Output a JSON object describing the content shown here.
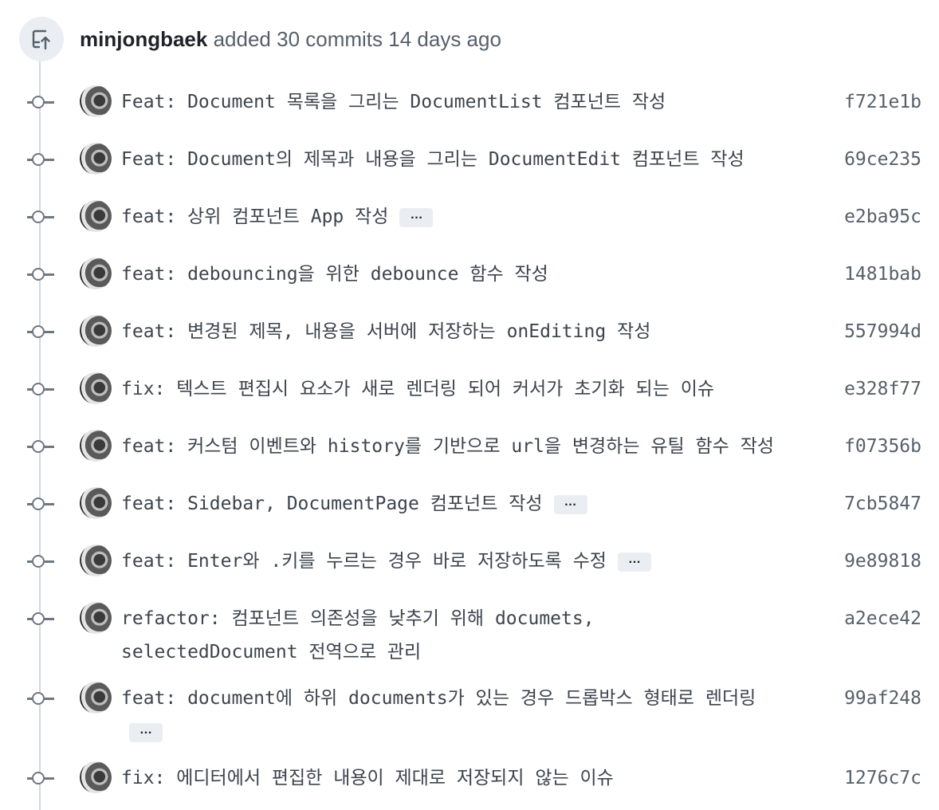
{
  "header": {
    "author": "minjongbaek",
    "action": " added 30 commits 14 days ago"
  },
  "commits": [
    {
      "message": "Feat: Document 목록을 그리는 DocumentList 컴포넌트 작성",
      "sha": "f721e1b"
    },
    {
      "message": "Feat: Document의 제목과 내용을 그리는 DocumentEdit 컴포넌트 작성",
      "sha": "69ce235"
    },
    {
      "message": "feat: 상위 컴포넌트 App 작성",
      "sha": "e2ba95c",
      "expander": "…"
    },
    {
      "message": "feat: debouncing을 위한 debounce 함수 작성",
      "sha": "1481bab"
    },
    {
      "message": "feat: 변경된 제목, 내용을 서버에 저장하는 onEditing 작성",
      "sha": "557994d"
    },
    {
      "message": "fix: 텍스트 편집시 요소가 새로 렌더링 되어 커서가 초기화 되는 이슈",
      "sha": "e328f77"
    },
    {
      "message": "feat: 커스텀 이벤트와 history를 기반으로 url을 변경하는 유틸 함수 작성",
      "sha": "f07356b"
    },
    {
      "message": "feat: Sidebar, DocumentPage 컴포넌트 작성",
      "sha": "7cb5847",
      "expander": "…"
    },
    {
      "message": "feat: Enter와 .키를 누르는 경우 바로 저장하도록 수정",
      "sha": "9e89818",
      "expander": "…"
    },
    {
      "message": "refactor: 컴포넌트 의존성을 낮추기 위해 documets,",
      "message_line2": "selectedDocument 전역으로 관리",
      "sha": "a2ece42"
    },
    {
      "message": "feat: document에 하위 documents가 있는 경우 드롭박스 형태로 렌더링",
      "sha": "99af248",
      "expander_line2": "…"
    },
    {
      "message": "fix: 에디터에서 편집한 내용이 제대로 저장되지 않는 이슈",
      "sha": "1276c7c"
    }
  ]
}
